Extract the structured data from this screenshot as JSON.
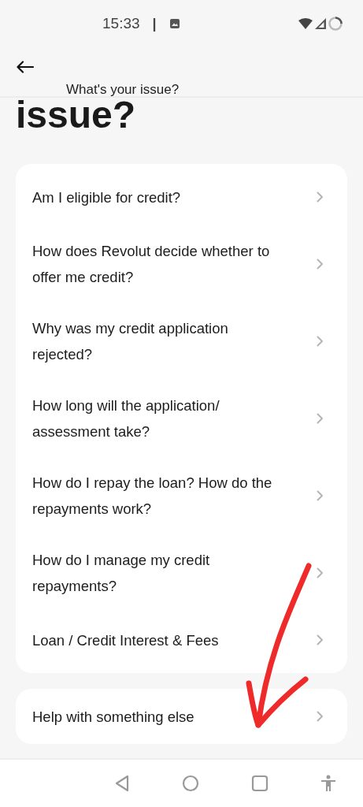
{
  "status_bar": {
    "time": "15:33",
    "separator": "|"
  },
  "header": {
    "title": "What's your issue?"
  },
  "heading": "issue?",
  "questions": [
    {
      "label": "Am I eligible for credit?"
    },
    {
      "label": "How does Revolut decide whether to offer me credit?"
    },
    {
      "label": "Why was my credit application rejected?"
    },
    {
      "label": "How long will the application/ assessment take?"
    },
    {
      "label": "How do I repay the loan? How do the repayments work?"
    },
    {
      "label": "How do I manage my credit repayments?"
    },
    {
      "label": "Loan / Credit Interest & Fees"
    }
  ],
  "other": {
    "label": "Help with something else"
  }
}
